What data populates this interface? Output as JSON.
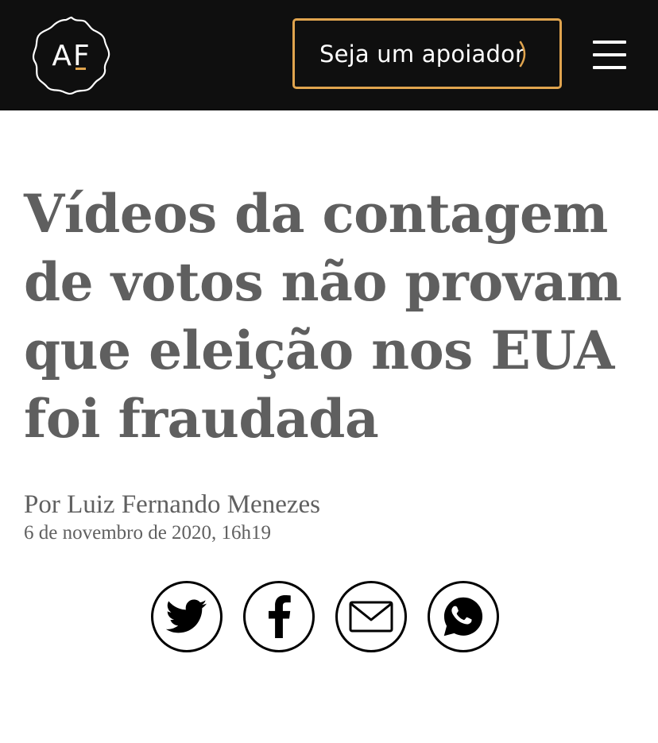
{
  "header": {
    "logo_text": "AF",
    "support_button_label": "Seja um apoiador",
    "colors": {
      "background": "#0f0f0f",
      "accent": "#e0a44e"
    }
  },
  "article": {
    "title": "Vídeos da contagem de votos não provam que eleição nos EUA foi fraudada",
    "byline": "Por Luiz Fernando Menezes",
    "date": "6 de novembro de 2020, 16h19"
  },
  "share": {
    "buttons": [
      {
        "icon": "twitter-icon"
      },
      {
        "icon": "facebook-icon"
      },
      {
        "icon": "email-icon"
      },
      {
        "icon": "whatsapp-icon"
      }
    ]
  }
}
